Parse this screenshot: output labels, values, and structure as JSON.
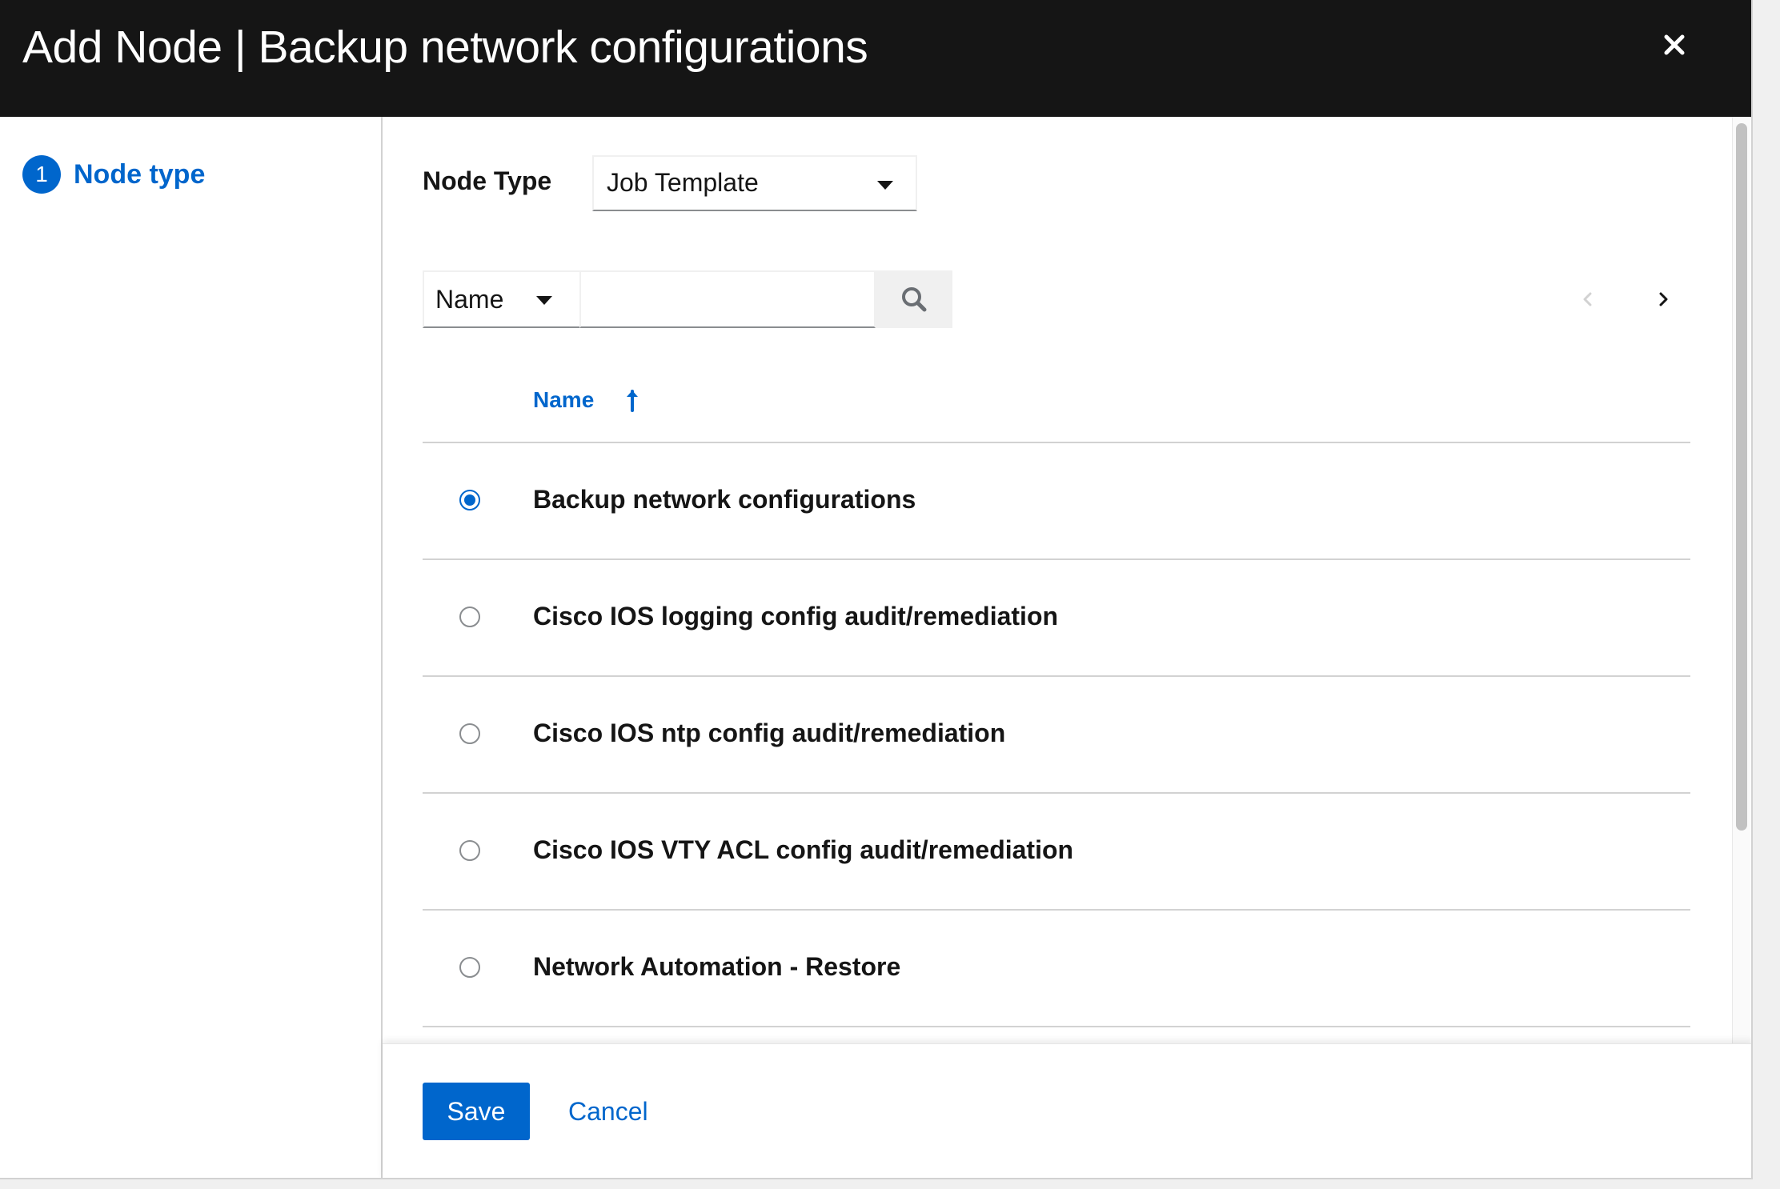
{
  "modal": {
    "title": "Add Node | Backup network configurations",
    "close_icon": "close-icon"
  },
  "wizard_nav": {
    "steps": [
      {
        "number": "1",
        "label": "Node type",
        "active": true
      }
    ]
  },
  "node_type": {
    "label": "Node Type",
    "selected": "Job Template"
  },
  "toolbar": {
    "filter_field": "Name",
    "search_value": "",
    "search_icon": "search-icon",
    "prev_icon": "chevron-left-icon",
    "next_icon": "chevron-right-icon",
    "prev_disabled": true
  },
  "table": {
    "columns": [
      {
        "label": "Name",
        "sort": "ascending",
        "sort_icon": "sort-ascending-icon"
      }
    ],
    "rows": [
      {
        "name": "Backup network configurations",
        "selected": true
      },
      {
        "name": "Cisco IOS logging config audit/remediation",
        "selected": false
      },
      {
        "name": "Cisco IOS ntp config audit/remediation",
        "selected": false
      },
      {
        "name": "Cisco IOS VTY ACL config audit/remediation",
        "selected": false
      },
      {
        "name": "Network Automation - Restore",
        "selected": false
      }
    ]
  },
  "footer": {
    "save_label": "Save",
    "cancel_label": "Cancel"
  },
  "colors": {
    "header_bg": "#151515",
    "accent": "#0066cc",
    "border": "#d2d2d2",
    "disabled": "#d2d2d2"
  }
}
